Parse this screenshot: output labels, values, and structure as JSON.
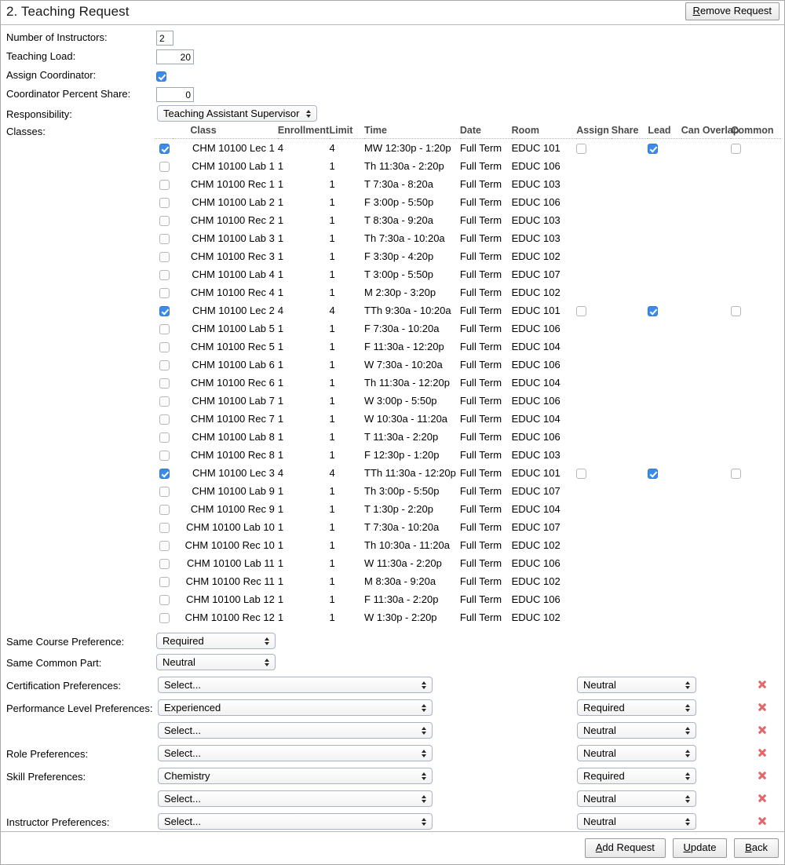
{
  "header": {
    "title": "2. Teaching Request",
    "remove_button": {
      "accel": "R",
      "rest": "emove Request"
    }
  },
  "form": {
    "number_of_instructors": {
      "label": "Number of Instructors:",
      "value": "2"
    },
    "teaching_load": {
      "label": "Teaching Load:",
      "value": "20"
    },
    "assign_coordinator": {
      "label": "Assign Coordinator:",
      "checked": true
    },
    "coordinator_percent_share": {
      "label": "Coordinator Percent Share:",
      "value": "0"
    },
    "responsibility": {
      "label": "Responsibility:",
      "value": "Teaching Assistant Supervisor"
    },
    "classes_label": "Classes:"
  },
  "classes_table": {
    "columns": [
      "Class",
      "Enrollment",
      "Limit",
      "Time",
      "Date",
      "Room",
      "Assign",
      "Share",
      "Lead",
      "Can Overlap",
      "Common"
    ],
    "rows": [
      {
        "checked": true,
        "indent": 0,
        "name": "CHM 10100 Lec 1",
        "enrollment": "4",
        "limit": "4",
        "time": "MW 12:30p - 1:20p",
        "date": "Full Term",
        "room": "EDUC 101",
        "flags": true,
        "assign": false,
        "lead": true,
        "common": false
      },
      {
        "checked": false,
        "indent": 1,
        "name": "CHM 10100 Lab 1",
        "enrollment": "1",
        "limit": "1",
        "time": "Th 11:30a - 2:20p",
        "date": "Full Term",
        "room": "EDUC 106",
        "flags": false
      },
      {
        "checked": false,
        "indent": 2,
        "name": "CHM 10100 Rec 1",
        "enrollment": "1",
        "limit": "1",
        "time": "T 7:30a - 8:20a",
        "date": "Full Term",
        "room": "EDUC 103",
        "flags": false
      },
      {
        "checked": false,
        "indent": 1,
        "name": "CHM 10100 Lab 2",
        "enrollment": "1",
        "limit": "1",
        "time": "F 3:00p - 5:50p",
        "date": "Full Term",
        "room": "EDUC 106",
        "flags": false
      },
      {
        "checked": false,
        "indent": 2,
        "name": "CHM 10100 Rec 2",
        "enrollment": "1",
        "limit": "1",
        "time": "T 8:30a - 9:20a",
        "date": "Full Term",
        "room": "EDUC 103",
        "flags": false
      },
      {
        "checked": false,
        "indent": 1,
        "name": "CHM 10100 Lab 3",
        "enrollment": "1",
        "limit": "1",
        "time": "Th 7:30a - 10:20a",
        "date": "Full Term",
        "room": "EDUC 103",
        "flags": false
      },
      {
        "checked": false,
        "indent": 2,
        "name": "CHM 10100 Rec 3",
        "enrollment": "1",
        "limit": "1",
        "time": "F 3:30p - 4:20p",
        "date": "Full Term",
        "room": "EDUC 102",
        "flags": false
      },
      {
        "checked": false,
        "indent": 1,
        "name": "CHM 10100 Lab 4",
        "enrollment": "1",
        "limit": "1",
        "time": "T 3:00p - 5:50p",
        "date": "Full Term",
        "room": "EDUC 107",
        "flags": false
      },
      {
        "checked": false,
        "indent": 2,
        "name": "CHM 10100 Rec 4",
        "enrollment": "1",
        "limit": "1",
        "time": "M 2:30p - 3:20p",
        "date": "Full Term",
        "room": "EDUC 102",
        "flags": false
      },
      {
        "checked": true,
        "indent": 0,
        "name": "CHM 10100 Lec 2",
        "enrollment": "4",
        "limit": "4",
        "time": "TTh 9:30a - 10:20a",
        "date": "Full Term",
        "room": "EDUC 101",
        "flags": true,
        "assign": false,
        "lead": true,
        "common": false
      },
      {
        "checked": false,
        "indent": 1,
        "name": "CHM 10100 Lab 5",
        "enrollment": "1",
        "limit": "1",
        "time": "F 7:30a - 10:20a",
        "date": "Full Term",
        "room": "EDUC 106",
        "flags": false
      },
      {
        "checked": false,
        "indent": 2,
        "name": "CHM 10100 Rec 5",
        "enrollment": "1",
        "limit": "1",
        "time": "F 11:30a - 12:20p",
        "date": "Full Term",
        "room": "EDUC 104",
        "flags": false
      },
      {
        "checked": false,
        "indent": 1,
        "name": "CHM 10100 Lab 6",
        "enrollment": "1",
        "limit": "1",
        "time": "W 7:30a - 10:20a",
        "date": "Full Term",
        "room": "EDUC 106",
        "flags": false
      },
      {
        "checked": false,
        "indent": 2,
        "name": "CHM 10100 Rec 6",
        "enrollment": "1",
        "limit": "1",
        "time": "Th 11:30a - 12:20p",
        "date": "Full Term",
        "room": "EDUC 104",
        "flags": false
      },
      {
        "checked": false,
        "indent": 1,
        "name": "CHM 10100 Lab 7",
        "enrollment": "1",
        "limit": "1",
        "time": "W 3:00p - 5:50p",
        "date": "Full Term",
        "room": "EDUC 106",
        "flags": false
      },
      {
        "checked": false,
        "indent": 2,
        "name": "CHM 10100 Rec 7",
        "enrollment": "1",
        "limit": "1",
        "time": "W 10:30a - 11:20a",
        "date": "Full Term",
        "room": "EDUC 104",
        "flags": false
      },
      {
        "checked": false,
        "indent": 1,
        "name": "CHM 10100 Lab 8",
        "enrollment": "1",
        "limit": "1",
        "time": "T 11:30a - 2:20p",
        "date": "Full Term",
        "room": "EDUC 106",
        "flags": false
      },
      {
        "checked": false,
        "indent": 2,
        "name": "CHM 10100 Rec 8",
        "enrollment": "1",
        "limit": "1",
        "time": "F 12:30p - 1:20p",
        "date": "Full Term",
        "room": "EDUC 103",
        "flags": false
      },
      {
        "checked": true,
        "indent": 0,
        "name": "CHM 10100 Lec 3",
        "enrollment": "4",
        "limit": "4",
        "time": "TTh 11:30a - 12:20p",
        "date": "Full Term",
        "room": "EDUC 101",
        "flags": true,
        "assign": false,
        "lead": true,
        "common": false
      },
      {
        "checked": false,
        "indent": 1,
        "name": "CHM 10100 Lab 9",
        "enrollment": "1",
        "limit": "1",
        "time": "Th 3:00p - 5:50p",
        "date": "Full Term",
        "room": "EDUC 107",
        "flags": false
      },
      {
        "checked": false,
        "indent": 2,
        "name": "CHM 10100 Rec 9",
        "enrollment": "1",
        "limit": "1",
        "time": "T 1:30p - 2:20p",
        "date": "Full Term",
        "room": "EDUC 104",
        "flags": false
      },
      {
        "checked": false,
        "indent": 1,
        "name": "CHM 10100 Lab 10",
        "enrollment": "1",
        "limit": "1",
        "time": "T 7:30a - 10:20a",
        "date": "Full Term",
        "room": "EDUC 107",
        "flags": false
      },
      {
        "checked": false,
        "indent": 2,
        "name": "CHM 10100 Rec 10",
        "enrollment": "1",
        "limit": "1",
        "time": "Th 10:30a - 11:20a",
        "date": "Full Term",
        "room": "EDUC 102",
        "flags": false
      },
      {
        "checked": false,
        "indent": 1,
        "name": "CHM 10100 Lab 11",
        "enrollment": "1",
        "limit": "1",
        "time": "W 11:30a - 2:20p",
        "date": "Full Term",
        "room": "EDUC 106",
        "flags": false
      },
      {
        "checked": false,
        "indent": 2,
        "name": "CHM 10100 Rec 11",
        "enrollment": "1",
        "limit": "1",
        "time": "M 8:30a - 9:20a",
        "date": "Full Term",
        "room": "EDUC 102",
        "flags": false
      },
      {
        "checked": false,
        "indent": 1,
        "name": "CHM 10100 Lab 12",
        "enrollment": "1",
        "limit": "1",
        "time": "F 11:30a - 2:20p",
        "date": "Full Term",
        "room": "EDUC 106",
        "flags": false
      },
      {
        "checked": false,
        "indent": 2,
        "name": "CHM 10100 Rec 12",
        "enrollment": "1",
        "limit": "1",
        "time": "W 1:30p - 2:20p",
        "date": "Full Term",
        "room": "EDUC 102",
        "flags": false
      }
    ]
  },
  "preferences": {
    "same_course": {
      "label": "Same Course Preference:",
      "value": "Required"
    },
    "same_common_part": {
      "label": "Same Common Part:",
      "value": "Neutral"
    },
    "rows": [
      {
        "label": "Certification Preferences:",
        "left": "Select...",
        "right": "Neutral"
      },
      {
        "label": "Performance Level Preferences:",
        "left": "Experienced",
        "right": "Required"
      },
      {
        "label": "",
        "left": "Select...",
        "right": "Neutral"
      },
      {
        "label": "Role Preferences:",
        "left": "Select...",
        "right": "Neutral"
      },
      {
        "label": "Skill Preferences:",
        "left": "Chemistry",
        "right": "Required"
      },
      {
        "label": "",
        "left": "Select...",
        "right": "Neutral"
      },
      {
        "label": "Instructor Preferences:",
        "left": "Select...",
        "right": "Neutral"
      }
    ],
    "delete_icon": "delete-x-icon"
  },
  "footer": {
    "add_request": {
      "accel": "A",
      "rest": "dd Request"
    },
    "update": {
      "accel": "U",
      "rest": "pdate"
    },
    "back": {
      "accel": "B",
      "rest": "ack"
    }
  },
  "colors": {
    "checkbox_on": "#3b8bed",
    "delete_icon": "#e0686b",
    "header_text": "#4a4a4a"
  }
}
